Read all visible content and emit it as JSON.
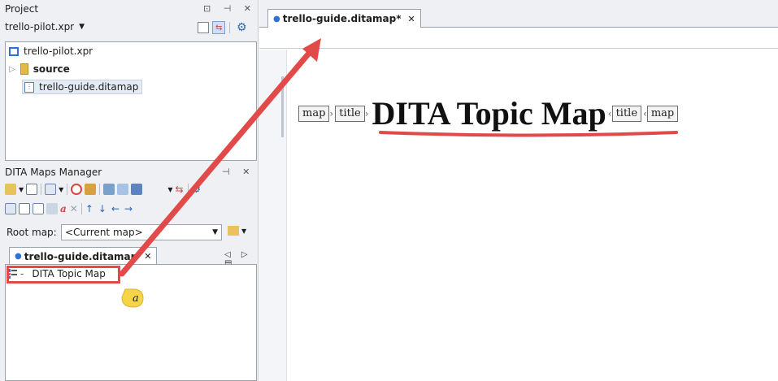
{
  "project_panel": {
    "title": "Project",
    "controls": "⊡ ⊣ ✕",
    "project_file": "trello-pilot.xpr",
    "tree": [
      {
        "label": "trello-pilot.xpr",
        "icon": "project-icon"
      },
      {
        "label": "source",
        "icon": "folder-icon",
        "expander": "▷"
      },
      {
        "label": "trello-guide.ditamap",
        "icon": "ditamap-file-icon"
      }
    ]
  },
  "maps_manager": {
    "title": "DITA Maps Manager",
    "controls": "⊣ ✕",
    "root_map_label": "Root map:",
    "root_map_value": "<Current map>",
    "tab_label": "trello-guide.ditamap",
    "tab_nav": "◁ ▷ ▤",
    "tree": [
      {
        "label": "DITA Topic Map",
        "prefix": "-",
        "icon": "map-tree-icon"
      }
    ]
  },
  "editor": {
    "tab_label": "trello-guide.ditamap*",
    "tags": {
      "map_open": "map",
      "title_open": "title",
      "title_close": "title",
      "map_close": "map"
    },
    "title_text": "DITA Topic Map"
  },
  "callout": {
    "label": "a"
  },
  "colors": {
    "accent": "#e24a4a",
    "dot": "#2f6fd8",
    "callout": "#f5d547"
  }
}
